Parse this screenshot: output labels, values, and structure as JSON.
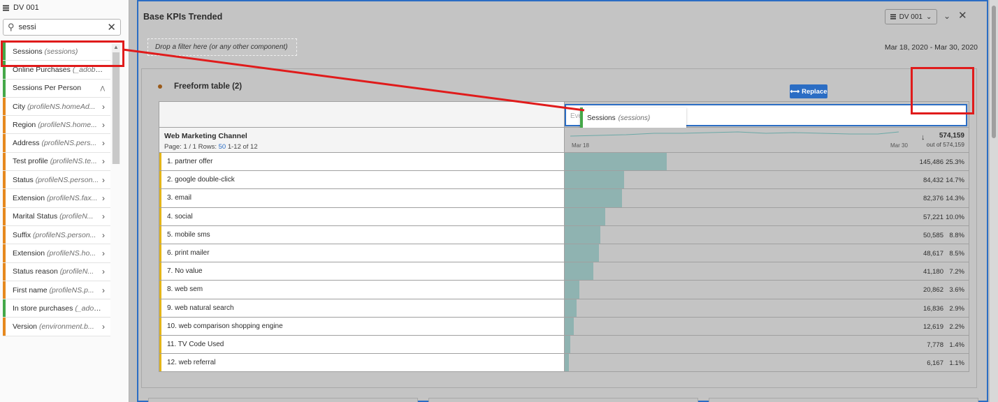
{
  "sidebar": {
    "data_view": "DV 001",
    "search": {
      "value": "sessi",
      "placeholder": ""
    },
    "items": [
      {
        "label": "Sessions",
        "sub": "(sessions)",
        "color": "#45a849",
        "suffix": ""
      },
      {
        "label": "Online Purchases",
        "sub": "(_adobea...",
        "color": "#45a849",
        "suffix": ""
      },
      {
        "label": "Sessions Per Person",
        "sub": "",
        "color": "#45a849",
        "suffix": "tiny"
      },
      {
        "label": "City",
        "sub": "(profileNS.homeAd...",
        "color": "#e6891f",
        "suffix": "chev"
      },
      {
        "label": "Region",
        "sub": "(profileNS.home...",
        "color": "#e6891f",
        "suffix": "chev"
      },
      {
        "label": "Address",
        "sub": "(profileNS.pers...",
        "color": "#e6891f",
        "suffix": "chev"
      },
      {
        "label": "Test profile",
        "sub": "(profileNS.te...",
        "color": "#e6891f",
        "suffix": "chev"
      },
      {
        "label": "Status",
        "sub": "(profileNS.person...",
        "color": "#e6891f",
        "suffix": "chev"
      },
      {
        "label": "Extension",
        "sub": "(profileNS.fax...",
        "color": "#e6891f",
        "suffix": "chev"
      },
      {
        "label": "Marital Status",
        "sub": "(profileN...",
        "color": "#e6891f",
        "suffix": "chev"
      },
      {
        "label": "Suffix",
        "sub": "(profileNS.person...",
        "color": "#e6891f",
        "suffix": "chev"
      },
      {
        "label": "Extension",
        "sub": "(profileNS.ho...",
        "color": "#e6891f",
        "suffix": "chev"
      },
      {
        "label": "Status reason",
        "sub": "(profileN...",
        "color": "#e6891f",
        "suffix": "chev"
      },
      {
        "label": "First name",
        "sub": "(profileNS.p...",
        "color": "#e6891f",
        "suffix": "chev"
      },
      {
        "label": "In store purchases",
        "sub": "(_adobe...",
        "color": "#45a849",
        "suffix": ""
      },
      {
        "label": "Version",
        "sub": "(environment.b...",
        "color": "#e6891f",
        "suffix": "chev"
      }
    ]
  },
  "panel": {
    "title": "Base KPIs Trended",
    "dv_picker": "DV 001",
    "filter_placeholder": "Drop a filter here (or any other component)",
    "date_range": "Mar 18, 2020 - Mar 30, 2020"
  },
  "freeform": {
    "title": "Freeform table (2)",
    "drop_ghost": "Events",
    "drag_label": "Sessions",
    "drag_sub": "(sessions)",
    "replace_label": "Replace",
    "dimension": "Web Marketing Channel",
    "page_prefix": "Page: 1 / 1 Rows:",
    "rows_per_page": "50",
    "range": "1-12 of 12",
    "spark_start": "Mar 18",
    "spark_end": "Mar 30",
    "total": "574,159",
    "total_of": "out of 574,159",
    "rows": [
      {
        "name": "1. partner offer",
        "value": "145,486",
        "pct": "25.3%",
        "share": 0.253
      },
      {
        "name": "2. google double-click",
        "value": "84,432",
        "pct": "14.7%",
        "share": 0.147
      },
      {
        "name": "3. email",
        "value": "82,376",
        "pct": "14.3%",
        "share": 0.143
      },
      {
        "name": "4. social",
        "value": "57,221",
        "pct": "10.0%",
        "share": 0.1
      },
      {
        "name": "5. mobile sms",
        "value": "50,585",
        "pct": "8.8%",
        "share": 0.088
      },
      {
        "name": "6. print mailer",
        "value": "48,617",
        "pct": "8.5%",
        "share": 0.085
      },
      {
        "name": "7. No value",
        "value": "41,180",
        "pct": "7.2%",
        "share": 0.072
      },
      {
        "name": "8. web sem",
        "value": "20,862",
        "pct": "3.6%",
        "share": 0.036
      },
      {
        "name": "9. web natural search",
        "value": "16,836",
        "pct": "2.9%",
        "share": 0.029
      },
      {
        "name": "10. web comparison shopping engine",
        "value": "12,619",
        "pct": "2.2%",
        "share": 0.022
      },
      {
        "name": "11. TV Code Used",
        "value": "7,778",
        "pct": "1.4%",
        "share": 0.014
      },
      {
        "name": "12. web referral",
        "value": "6,167",
        "pct": "1.1%",
        "share": 0.011
      }
    ]
  },
  "colors": {
    "accent": "#2b6dc4",
    "annotation": "#e01b1b",
    "bar": "#8fb3b1",
    "metric": "#45a849",
    "dimension": "#e6891f"
  }
}
